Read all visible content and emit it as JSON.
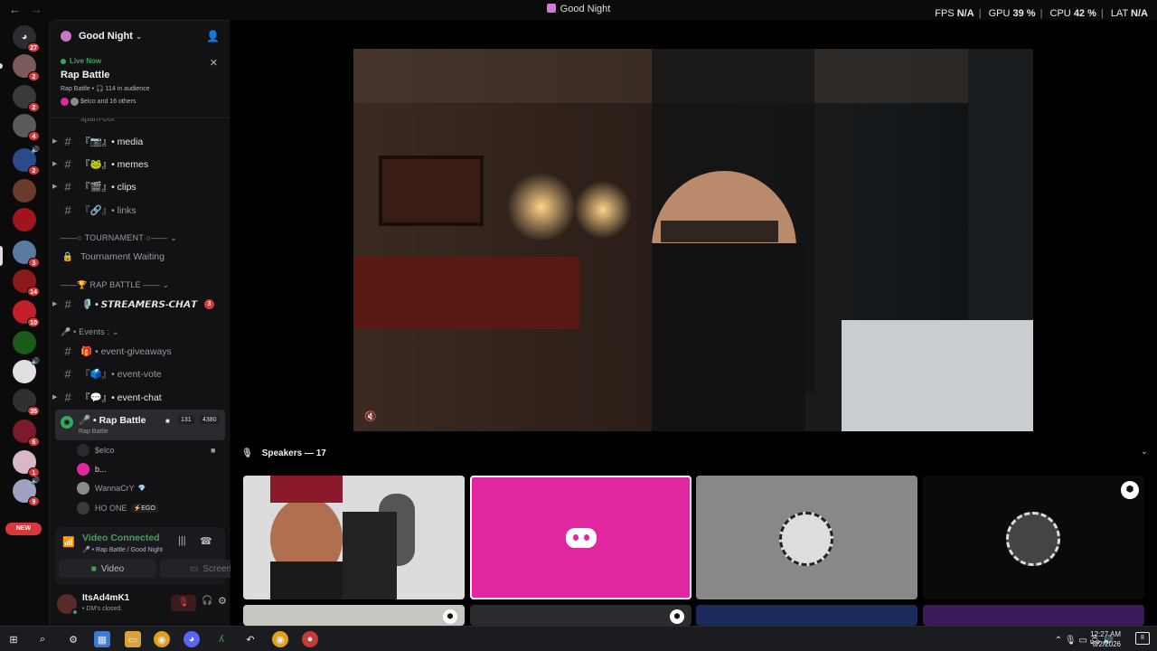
{
  "window": {
    "title": "Good Night",
    "back": "←",
    "forward": "→"
  },
  "overlay": {
    "fps_label": "FPS",
    "fps_value": "N/A",
    "gpu_label": "GPU",
    "gpu_value": "39 %",
    "cpu_label": "CPU",
    "cpu_value": "42 %",
    "lat_label": "LAT",
    "lat_value": "N/A"
  },
  "rail": {
    "badges": [
      "27",
      "2",
      "2",
      "4",
      "2",
      "3",
      "14",
      "10",
      "35",
      "6",
      "1",
      "9"
    ],
    "new_label": "NEW"
  },
  "server": {
    "name": "Good Night",
    "chevron": "⌄"
  },
  "live": {
    "label": "Live Now",
    "title": "Rap Battle",
    "subtitle": "Rap Battle • 🎧 114 in audience",
    "others": "$elco and 16 others"
  },
  "channels": [
    {
      "name": "spam-bot"
    },
    {
      "name": "『📷』• media"
    },
    {
      "name": "『🐸』• memes"
    },
    {
      "name": "『🎬』• clips"
    },
    {
      "name": "『🔗』• links"
    }
  ],
  "categories": {
    "tournament": "——○ TOURNAMENT ○—— ⌄",
    "rap_battle": "——🏆 RAP BATTLE —— ⌄",
    "events": "🎤 • Events : ⌄"
  },
  "tournament_channel": "Tournament Waiting",
  "streamers_channel": "🎙️ • 𝙎𝙏𝙍𝙀𝘼𝙈𝙀𝙍𝙎-𝘾𝙃𝘼𝙏",
  "streamers_mention": "3",
  "event_channels": [
    {
      "name": "🎁 • event-giveaways"
    },
    {
      "name": "『🗳️』• event-vote"
    },
    {
      "name": "『💬』• event-chat"
    }
  ],
  "voice_channel": {
    "name": "🎤 • Rap Battle",
    "subtitle": "Rap Battle",
    "count_video": "131",
    "count_total": "4380"
  },
  "voice_users": [
    {
      "name": "$elco",
      "tag": ""
    },
    {
      "name": "b...",
      "tag": ""
    },
    {
      "name": "WannaCrY",
      "tag": "💎"
    },
    {
      "name": "HO ONE",
      "tag": "⚡EGO"
    }
  ],
  "voice_panel": {
    "status": "Video Connected",
    "location": "🎤 • Rap Battle / Good Night",
    "video_label": "Video",
    "screen_label": "Screen"
  },
  "user": {
    "name": "ItsAd4mK1",
    "status": "• DM's closed."
  },
  "stage": {
    "speakers_label": "Speakers — 17"
  },
  "taskbar": {
    "time": "12:27 AM",
    "date": "8/2/2026",
    "notif_count": "8"
  },
  "colors": {
    "accent_green": "#3ba55d",
    "mention_red": "#da373c",
    "discord_pink": "#e1279f"
  }
}
